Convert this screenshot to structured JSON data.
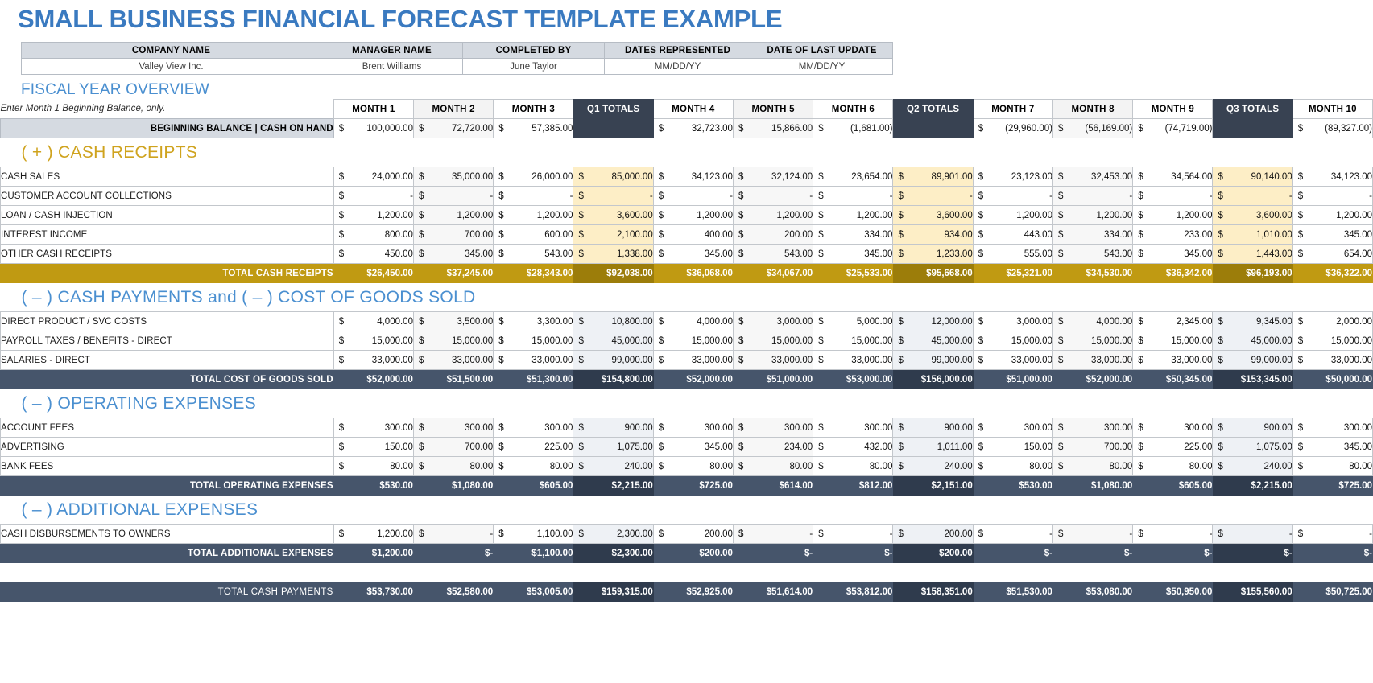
{
  "title": "SMALL BUSINESS FINANCIAL FORECAST TEMPLATE EXAMPLE",
  "accent_blue": "#4a8fd0",
  "accent_gold": "#c09a12",
  "accent_navy": "#46556b",
  "info": {
    "headers": [
      "COMPANY NAME",
      "MANAGER NAME",
      "COMPLETED BY",
      "DATES REPRESENTED",
      "DATE OF LAST UPDATE"
    ],
    "values": [
      "Valley View Inc.",
      "Brent Williams",
      "June Taylor",
      "MM/DD/YY",
      "MM/DD/YY"
    ]
  },
  "fiscal_year_overview": {
    "heading": "FISCAL YEAR OVERVIEW",
    "note": "Enter Month 1 Beginning Balance, only.",
    "columns": [
      "MONTH 1",
      "MONTH 2",
      "MONTH 3",
      "Q1 TOTALS",
      "MONTH 4",
      "MONTH 5",
      "MONTH 6",
      "Q2 TOTALS",
      "MONTH 7",
      "MONTH 8",
      "MONTH 9",
      "Q3 TOTALS",
      "MONTH 10"
    ],
    "beginning_balance_label": "BEGINNING BALANCE  |  CASH ON HAND",
    "beginning_balance": [
      "100,000.00",
      "72,720.00",
      "57,385.00",
      "",
      "32,723.00",
      "15,866.00",
      "(1,681.00)",
      "",
      "(29,960.00)",
      "(56,169.00)",
      "(74,719.00)",
      "",
      "(89,327.00)"
    ]
  },
  "sections": [
    {
      "heading": "( + )  CASH RECEIPTS",
      "heading_color": "gold",
      "rows": [
        {
          "label": "CASH SALES",
          "values": [
            "24,000.00",
            "35,000.00",
            "26,000.00",
            "85,000.00",
            "34,123.00",
            "32,124.00",
            "23,654.00",
            "89,901.00",
            "23,123.00",
            "32,453.00",
            "34,564.00",
            "90,140.00",
            "34,123.00"
          ]
        },
        {
          "label": "CUSTOMER ACCOUNT COLLECTIONS",
          "values": [
            "-",
            "-",
            "-",
            "-",
            "-",
            "-",
            "-",
            "-",
            "-",
            "-",
            "-",
            "-",
            "-"
          ]
        },
        {
          "label": "LOAN / CASH INJECTION",
          "values": [
            "1,200.00",
            "1,200.00",
            "1,200.00",
            "3,600.00",
            "1,200.00",
            "1,200.00",
            "1,200.00",
            "3,600.00",
            "1,200.00",
            "1,200.00",
            "1,200.00",
            "3,600.00",
            "1,200.00"
          ]
        },
        {
          "label": "INTEREST INCOME",
          "values": [
            "800.00",
            "700.00",
            "600.00",
            "2,100.00",
            "400.00",
            "200.00",
            "334.00",
            "934.00",
            "443.00",
            "334.00",
            "233.00",
            "1,010.00",
            "345.00"
          ]
        },
        {
          "label": "OTHER CASH RECEIPTS",
          "values": [
            "450.00",
            "345.00",
            "543.00",
            "1,338.00",
            "345.00",
            "543.00",
            "345.00",
            "1,233.00",
            "555.00",
            "543.00",
            "345.00",
            "1,443.00",
            "654.00"
          ]
        }
      ],
      "total": {
        "label": "TOTAL CASH RECEIPTS",
        "style": "gold",
        "values": [
          "26,450.00",
          "37,245.00",
          "28,343.00",
          "92,038.00",
          "36,068.00",
          "34,067.00",
          "25,533.00",
          "95,668.00",
          "25,321.00",
          "34,530.00",
          "36,342.00",
          "96,193.00",
          "36,322.00"
        ]
      }
    },
    {
      "heading": "( – )  CASH PAYMENTS and ( – )  COST OF GOODS SOLD",
      "heading_color": "blue",
      "rows": [
        {
          "label": "DIRECT PRODUCT / SVC COSTS",
          "values": [
            "4,000.00",
            "3,500.00",
            "3,300.00",
            "10,800.00",
            "4,000.00",
            "3,000.00",
            "5,000.00",
            "12,000.00",
            "3,000.00",
            "4,000.00",
            "2,345.00",
            "9,345.00",
            "2,000.00"
          ]
        },
        {
          "label": "PAYROLL TAXES / BENEFITS - DIRECT",
          "values": [
            "15,000.00",
            "15,000.00",
            "15,000.00",
            "45,000.00",
            "15,000.00",
            "15,000.00",
            "15,000.00",
            "45,000.00",
            "15,000.00",
            "15,000.00",
            "15,000.00",
            "45,000.00",
            "15,000.00"
          ]
        },
        {
          "label": "SALARIES - DIRECT",
          "values": [
            "33,000.00",
            "33,000.00",
            "33,000.00",
            "99,000.00",
            "33,000.00",
            "33,000.00",
            "33,000.00",
            "99,000.00",
            "33,000.00",
            "33,000.00",
            "33,000.00",
            "99,000.00",
            "33,000.00"
          ]
        }
      ],
      "total": {
        "label": "TOTAL COST OF GOODS SOLD",
        "style": "navy",
        "values": [
          "52,000.00",
          "51,500.00",
          "51,300.00",
          "154,800.00",
          "52,000.00",
          "51,000.00",
          "53,000.00",
          "156,000.00",
          "51,000.00",
          "52,000.00",
          "50,345.00",
          "153,345.00",
          "50,000.00"
        ]
      }
    },
    {
      "heading": "( – )  OPERATING EXPENSES",
      "heading_color": "blue",
      "rows": [
        {
          "label": "ACCOUNT FEES",
          "values": [
            "300.00",
            "300.00",
            "300.00",
            "900.00",
            "300.00",
            "300.00",
            "300.00",
            "900.00",
            "300.00",
            "300.00",
            "300.00",
            "900.00",
            "300.00"
          ]
        },
        {
          "label": "ADVERTISING",
          "values": [
            "150.00",
            "700.00",
            "225.00",
            "1,075.00",
            "345.00",
            "234.00",
            "432.00",
            "1,011.00",
            "150.00",
            "700.00",
            "225.00",
            "1,075.00",
            "345.00"
          ]
        },
        {
          "label": "BANK FEES",
          "values": [
            "80.00",
            "80.00",
            "80.00",
            "240.00",
            "80.00",
            "80.00",
            "80.00",
            "240.00",
            "80.00",
            "80.00",
            "80.00",
            "240.00",
            "80.00"
          ]
        }
      ],
      "total": {
        "label": "TOTAL OPERATING EXPENSES",
        "style": "navy",
        "values": [
          "530.00",
          "1,080.00",
          "605.00",
          "2,215.00",
          "725.00",
          "614.00",
          "812.00",
          "2,151.00",
          "530.00",
          "1,080.00",
          "605.00",
          "2,215.00",
          "725.00"
        ]
      }
    },
    {
      "heading": "( – )  ADDITIONAL EXPENSES",
      "heading_color": "blue",
      "rows": [
        {
          "label": "CASH DISBURSEMENTS TO OWNERS",
          "values": [
            "1,200.00",
            "-",
            "1,100.00",
            "2,300.00",
            "200.00",
            "-",
            "-",
            "200.00",
            "-",
            "-",
            "-",
            "-",
            "-"
          ]
        }
      ],
      "total": {
        "label": "TOTAL ADDITIONAL EXPENSES",
        "style": "navy",
        "values": [
          "1,200.00",
          "-",
          "1,100.00",
          "2,300.00",
          "200.00",
          "-",
          "-",
          "200.00",
          "-",
          "-",
          "-",
          "-",
          "-"
        ]
      }
    }
  ],
  "grand_total": {
    "label": "TOTAL CASH PAYMENTS",
    "values": [
      "53,730.00",
      "52,580.00",
      "53,005.00",
      "159,315.00",
      "52,925.00",
      "51,614.00",
      "53,812.00",
      "158,351.00",
      "51,530.00",
      "53,080.00",
      "50,950.00",
      "155,560.00",
      "50,725.00"
    ]
  },
  "currency_symbol": "$"
}
